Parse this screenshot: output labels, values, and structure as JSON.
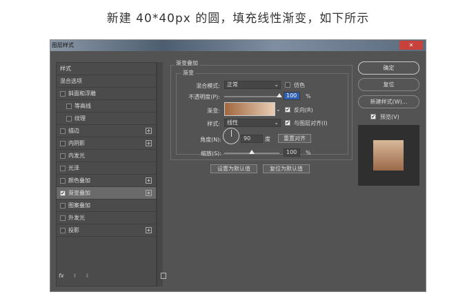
{
  "caption": "新建 40*40px 的圆，填充线性渐变，如下所示",
  "dialog": {
    "title": "图层样式",
    "close": "✕"
  },
  "left": {
    "items": [
      {
        "label": "样式",
        "checkbox": null
      },
      {
        "label": "混合选项",
        "checkbox": null
      },
      {
        "label": "斜面和浮雕",
        "checkbox": false
      },
      {
        "label": "等高线",
        "checkbox": false,
        "indent": true
      },
      {
        "label": "纹理",
        "checkbox": false,
        "indent": true
      },
      {
        "label": "描边",
        "checkbox": false,
        "plus": true
      },
      {
        "label": "内阴影",
        "checkbox": false,
        "plus": true
      },
      {
        "label": "内发光",
        "checkbox": false
      },
      {
        "label": "光泽",
        "checkbox": false
      },
      {
        "label": "颜色叠加",
        "checkbox": false,
        "plus": true
      },
      {
        "label": "渐变叠加",
        "checkbox": true,
        "plus": true,
        "selected": true
      },
      {
        "label": "图案叠加",
        "checkbox": false
      },
      {
        "label": "外发光",
        "checkbox": false
      },
      {
        "label": "投影",
        "checkbox": false,
        "plus": true
      }
    ],
    "fx": "fx",
    "up": "⬆",
    "down": "⬇",
    "trash": "🗑"
  },
  "panel": {
    "section": "渐变叠加",
    "group": "渐变",
    "blend_label": "混合模式:",
    "blend_value": "正常",
    "dither": "仿色",
    "dither_checked": false,
    "opacity_label": "不透明度(P):",
    "opacity_value": "100",
    "opacity_unit": "%",
    "opacity_fraction": 1.0,
    "gradient_label": "渐变:",
    "gradient_colors": [
      "#a0673f",
      "#e8cdb3"
    ],
    "reverse": "反向(R)",
    "reverse_checked": true,
    "style_label": "样式:",
    "style_value": "线性",
    "align": "与图层对齐(I)",
    "align_checked": true,
    "angle_label": "角度(N):",
    "angle_value": "90",
    "angle_unit": "度",
    "reset_align": "重置对齐",
    "scale_label": "缩放(S):",
    "scale_value": "100",
    "scale_unit": "%",
    "scale_fraction": 0.5,
    "set_default": "设置为默认值",
    "reset_default": "复位为默认值"
  },
  "right": {
    "ok": "确定",
    "reset": "复位",
    "new_style": "新建样式(W)...",
    "preview": "预览(V)",
    "preview_checked": true,
    "preview_colors": [
      "#d8b89a",
      "#9a6a48"
    ]
  }
}
